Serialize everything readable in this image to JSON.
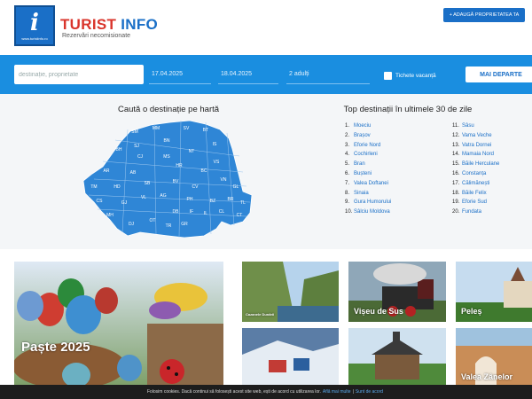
{
  "header": {
    "logo_caption": "www.turistinfo.ro",
    "brand_part1": "TURIST",
    "brand_part2": "INFO",
    "tagline": "Rezervări necomisionate",
    "add_property_label": "+ ADAUGĂ PROPRIETATEA TA"
  },
  "search": {
    "destination_placeholder": "destinație, proprietate",
    "checkin": "17.04.2025",
    "checkout": "18.04.2025",
    "guests": "2 adulți",
    "vouchers_label": "Tichete vacanță",
    "more_button": "MAI DEPARTE"
  },
  "map_section": {
    "title": "Caută o destinație pe hartă",
    "map_color": "#2f86d6",
    "county_codes": [
      "SM",
      "MM",
      "SV",
      "BT",
      "SJ",
      "BN",
      "IS",
      "BH",
      "CJ",
      "MS",
      "NT",
      "VS",
      "AR",
      "AB",
      "HR",
      "BC",
      "VN",
      "GL",
      "TM",
      "HD",
      "SB",
      "BV",
      "CV",
      "BR",
      "TL",
      "CS",
      "GJ",
      "VL",
      "AG",
      "PH",
      "BZ",
      "DB",
      "IF",
      "CT",
      "MH",
      "OT",
      "TR",
      "GR",
      "IL",
      "CL",
      "DJ"
    ]
  },
  "top_section": {
    "title": "Top destinații în ultimele 30 de zile",
    "left": [
      {
        "num": "1.",
        "name": "Moeciu"
      },
      {
        "num": "2.",
        "name": "Brașov"
      },
      {
        "num": "3.",
        "name": "Eforie Nord"
      },
      {
        "num": "4.",
        "name": "Cochirleni"
      },
      {
        "num": "5.",
        "name": "Bran"
      },
      {
        "num": "6.",
        "name": "Bușteni"
      },
      {
        "num": "7.",
        "name": "Valea Doftanei"
      },
      {
        "num": "8.",
        "name": "Sinaia"
      },
      {
        "num": "9.",
        "name": "Gura Humorului"
      },
      {
        "num": "10.",
        "name": "Sâlciu Moldova"
      }
    ],
    "right": [
      {
        "num": "11.",
        "name": "Sâsu"
      },
      {
        "num": "12.",
        "name": "Vama Veche"
      },
      {
        "num": "13.",
        "name": "Vatra Dornei"
      },
      {
        "num": "14.",
        "name": "Mamaia Nord"
      },
      {
        "num": "15.",
        "name": "Băile Herculane"
      },
      {
        "num": "16.",
        "name": "Constanța"
      },
      {
        "num": "17.",
        "name": "Călimănești"
      },
      {
        "num": "18.",
        "name": "Băile Felix"
      },
      {
        "num": "19.",
        "name": "Eforie Sud"
      },
      {
        "num": "20.",
        "name": "Fundata"
      }
    ]
  },
  "gallery": {
    "easter_label": "Paște 2025",
    "tile2_label": "Cazanele Dunării",
    "tile3_label": "Vișeu de Sus",
    "tile4_label": "Peleș",
    "tile5_label": "",
    "tile6_label": "",
    "tile7_label": "Valea Zânelor"
  },
  "cookie": {
    "text": "Folosim cookies. Dacă continui să folosești acest site web, ești de acord cu utilizarea lor.",
    "more_link": "Află mai multe",
    "accept_link": "Sunt de acord",
    "separator": "|"
  }
}
